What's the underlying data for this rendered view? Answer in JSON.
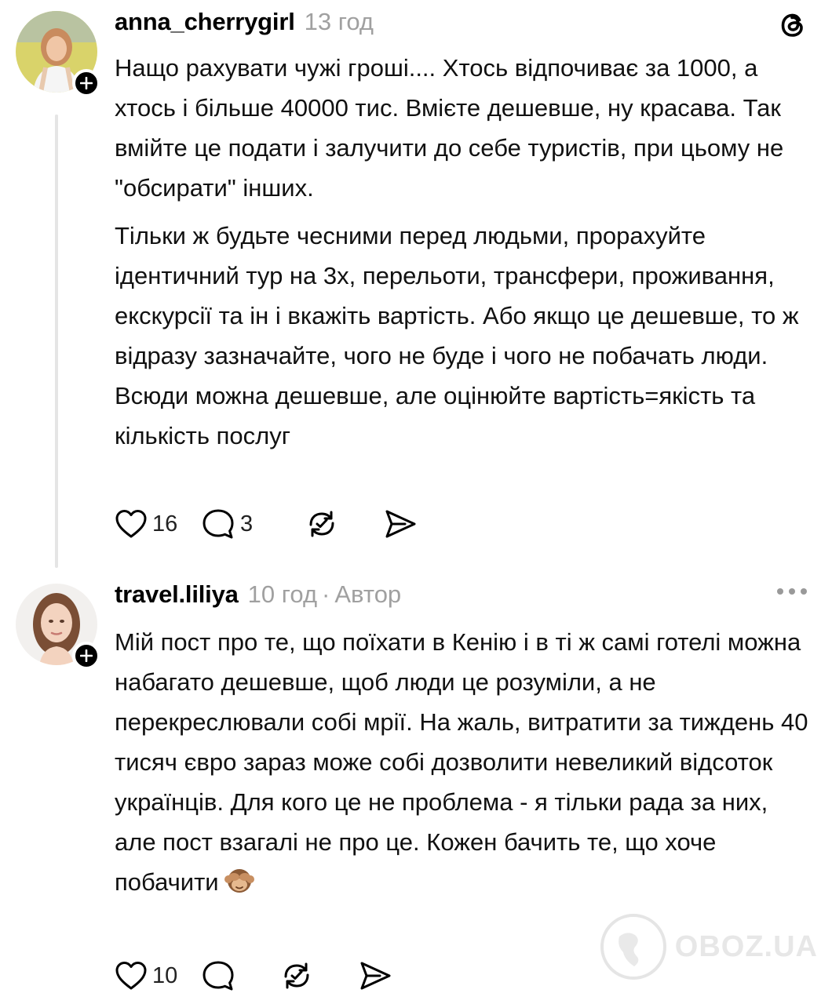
{
  "posts": [
    {
      "username": "anna_cherrygirl",
      "time": "13 год",
      "paragraphs": [
        "Нащо рахувати чужі гроші.... Хтось відпочиває за 1000, а хтось і більше 40000 тис. Вмієте дешевше, ну красава. Так вмійте це подати і залучити до себе туристів, при цьому не \"обсирати\" інших.",
        "Тільки ж будьте чесними перед людьми, прорахуйте ідентичний тур на 3х, перельоти, трансфери, проживання, екскурсії та ін і вкажіть вартість. Або якщо це дешевше, то ж відразу зазначайте, чого не буде і чого не побачать люди. Всюди можна дешевше, але оцінюйте вартість=якість та кількість послуг"
      ],
      "likes": "16",
      "replies": "3"
    },
    {
      "username": "travel.liliya",
      "time": "10 год",
      "separator": "·",
      "author_badge": "Автор",
      "paragraphs": [
        "Мій пост про те, що поїхати в Кенію і в ті ж самі готелі можна набагато дешевше, щоб люди це розуміли, а не перекреслювали собі мрії. На жаль, витратити за тиждень 40 тисяч євро зараз може собі дозволити невеликий відсоток українців. Для кого це не проблема - я тільки рада за них, але пост взагалі не про це. Кожен бачить те, що хоче побачити"
      ],
      "emoji": "🙈",
      "likes": "10"
    }
  ],
  "watermark": "OBOZ.UA",
  "icons": [
    "threads-logo-icon",
    "plus-icon",
    "heart-icon",
    "comment-icon",
    "repost-icon",
    "share-icon",
    "more-dots-icon",
    "globe-icon"
  ]
}
